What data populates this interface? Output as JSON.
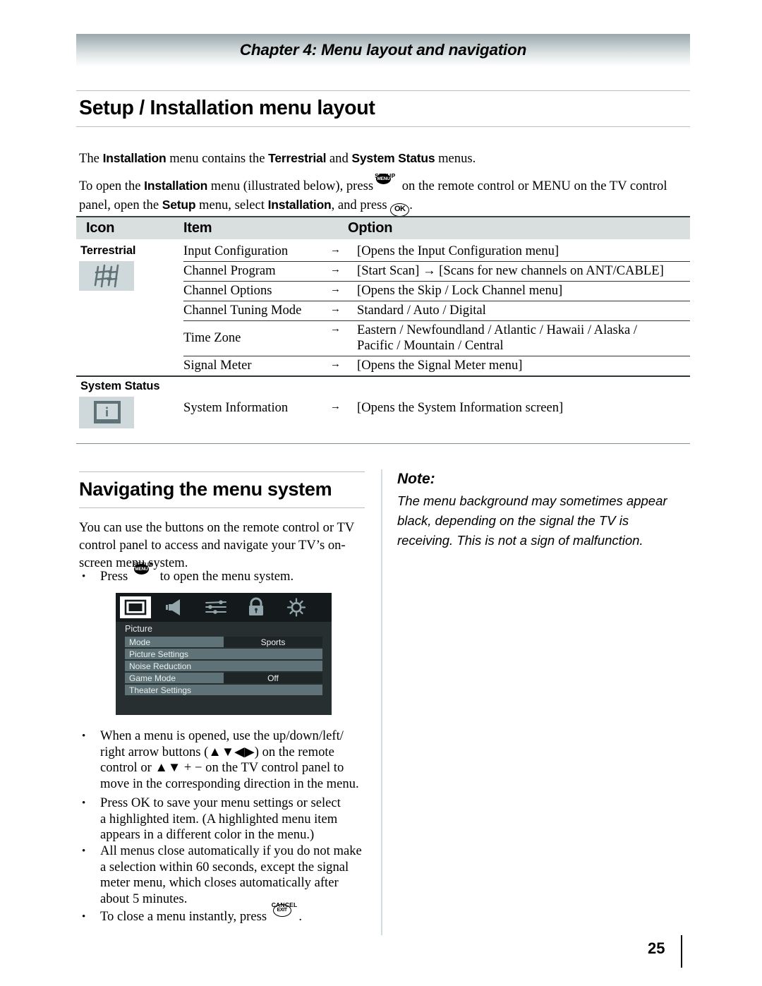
{
  "header": {
    "chapter_title": "Chapter 4: Menu layout and navigation"
  },
  "page_title": "Setup / Installation menu layout",
  "intro": {
    "line1_a": "The ",
    "line1_b": "Installation",
    "line1_c": " menu contains the ",
    "line1_d": "Terrestrial",
    "line1_e": " and ",
    "line1_f": "System Status",
    "line1_g": " menus.",
    "line2_a": "To open the ",
    "line2_b": "Installation",
    "line2_c": " menu (illustrated below), press",
    "line2_d": " on the remote control or MENU on the TV control",
    "line3_a": "panel, open the ",
    "line3_b": "Setup",
    "line3_c": " menu, select ",
    "line3_d": "Installation",
    "line3_e": ", and press ",
    "line3_f": "."
  },
  "keys": {
    "setup_cap": "SETUP",
    "menu_label": "MENU",
    "ok_label": "OK",
    "cancel_cap": "CANCEL",
    "exit_label": "EXIT"
  },
  "table": {
    "columns": [
      "Icon",
      "Item",
      "Option"
    ],
    "arrow": "→",
    "groups": [
      {
        "label": "Terrestrial",
        "icon": "antenna-icon",
        "rows": [
          {
            "item": "Input Configuration",
            "option": "[Opens the Input Configuration menu]",
            "option2": ""
          },
          {
            "item": "Channel Program",
            "option": "[Start Scan] → [Scans for new channels on ANT/CABLE]",
            "option2": ""
          },
          {
            "item": "Channel Options",
            "option": "[Opens the Skip / Lock Channel menu]",
            "option2": ""
          },
          {
            "item": "Channel Tuning Mode",
            "option": "Standard / Auto / Digital",
            "option2": ""
          },
          {
            "item": "Time Zone",
            "option": "Eastern / Newfoundland / Atlantic / Hawaii / Alaska /",
            "option2": "Pacific / Mountain / Central"
          },
          {
            "item": "Signal Meter",
            "option": "[Opens the Signal Meter menu]",
            "option2": ""
          }
        ]
      },
      {
        "label": "System Status",
        "icon": "info-screen-icon",
        "rows": [
          {
            "item": "System Information",
            "option": "[Opens the System Information screen]",
            "option2": ""
          }
        ]
      }
    ]
  },
  "navigating": {
    "title": "Navigating the menu system",
    "intro_l1": "You can use the buttons on the remote control or TV",
    "intro_l2": "control panel to access and navigate your TV’s on-",
    "intro_l3": "screen menu system.",
    "bullet_press_a": "Press",
    "bullet_press_b": "to open the menu system.",
    "bullets": [
      {
        "lines": [
          "When a menu is opened, use the up/down/left/",
          "right arrow buttons (▲▼◀▶) on the remote",
          "control or ▲▼ + − on the TV control panel to",
          "move in the corresponding direction in the menu."
        ]
      },
      {
        "lines": [
          "Press OK to save your menu settings or select",
          "a highlighted item. (A highlighted menu item",
          "appears in a different color in the menu.)"
        ]
      },
      {
        "lines": [
          "All menus close automatically if you do not make",
          "a selection within 60 seconds, except the signal",
          "meter menu, which closes automatically after",
          "about 5 minutes."
        ]
      },
      {
        "lines": [
          "To close a menu instantly, press"
        ]
      }
    ],
    "bullet_dot": "•"
  },
  "note": {
    "title": "Note:",
    "line1": "The menu background may sometimes appear",
    "line2": "black, depending on the signal the TV is",
    "line3": "receiving. This is not a sign of malfunction."
  },
  "tv_menu": {
    "icons": [
      "picture-icon",
      "speaker-icon",
      "sliders-icon",
      "lock-icon",
      "gear-icon"
    ],
    "active_icon": "picture-icon",
    "section_label": "Picture",
    "rows": [
      {
        "label": "Mode",
        "value": "Sports",
        "has_value": true
      },
      {
        "label": "Picture Settings",
        "value": "",
        "has_value": false
      },
      {
        "label": "Noise Reduction",
        "value": "",
        "has_value": false
      },
      {
        "label": "Game Mode",
        "value": "Off",
        "has_value": true
      },
      {
        "label": "Theater Settings",
        "value": "",
        "has_value": false
      }
    ]
  },
  "footer": {
    "page_number": "25"
  },
  "colors": {
    "band_top": "#9aa7ab",
    "table_header_bg": "#d9dede",
    "icon_box_bg": "#cfd8da",
    "icon_fg": "#5e7277",
    "osd_header_bg": "#14191b",
    "osd_body_bg": "#272f31",
    "osd_row_bg": "#5e7277",
    "osd_value_bg": "#1e2527",
    "divider": "#cfdde1"
  }
}
